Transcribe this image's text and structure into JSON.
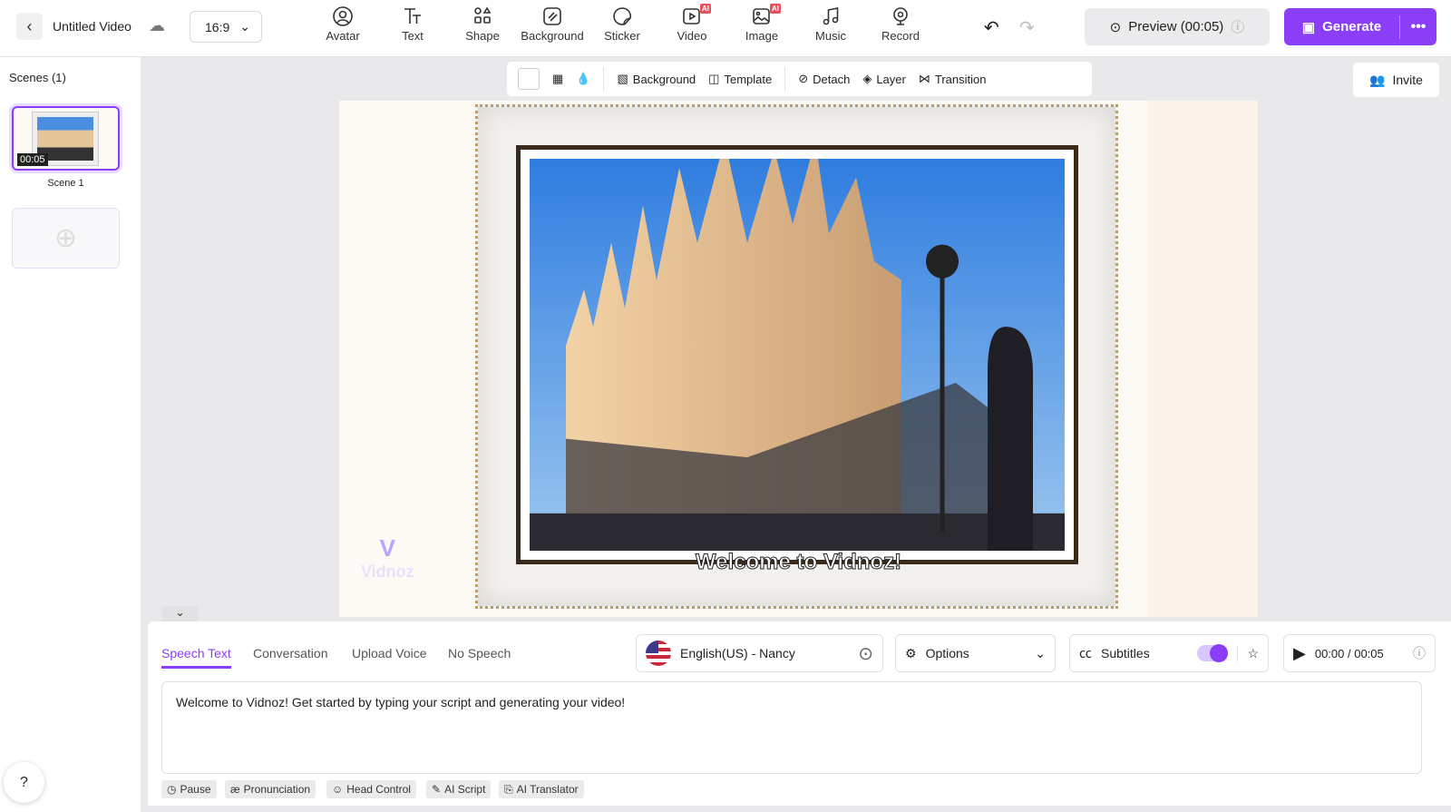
{
  "header": {
    "title": "Untitled Video",
    "aspect_ratio": "16:9",
    "tools": [
      {
        "label": "Avatar",
        "icon": "avatar-icon"
      },
      {
        "label": "Text",
        "icon": "text-icon"
      },
      {
        "label": "Shape",
        "icon": "shape-icon"
      },
      {
        "label": "Background",
        "icon": "background-icon"
      },
      {
        "label": "Sticker",
        "icon": "sticker-icon"
      },
      {
        "label": "Video",
        "icon": "video-icon",
        "badge": "AI"
      },
      {
        "label": "Image",
        "icon": "image-icon",
        "badge": "AI"
      },
      {
        "label": "Music",
        "icon": "music-icon"
      },
      {
        "label": "Record",
        "icon": "record-icon"
      }
    ],
    "preview": "Preview (00:05)",
    "generate": "Generate"
  },
  "sidebar": {
    "scenes_label": "Scenes (1)",
    "scenes": [
      {
        "name": "Scene 1",
        "duration": "00:05"
      }
    ]
  },
  "context_toolbar": {
    "background": "Background",
    "template": "Template",
    "detach": "Detach",
    "layer": "Layer",
    "transition": "Transition"
  },
  "invite": "Invite",
  "canvas": {
    "subtitle": "Welcome to Vidnoz!",
    "watermark": "Vidnoz"
  },
  "speech": {
    "tabs": [
      "Speech Text",
      "Conversation",
      "Upload Voice",
      "No Speech"
    ],
    "active_tab": "Speech Text",
    "voice": "English(US) - Nancy",
    "options": "Options",
    "subtitles": "Subtitles",
    "subtitles_on": true,
    "time": "00:00 / 00:05",
    "script": "Welcome to Vidnoz! Get started by typing your script and generating your video!",
    "chips": [
      "Pause",
      "Pronunciation",
      "Head Control",
      "AI Script",
      "AI Translator"
    ]
  },
  "colors": {
    "accent": "#8a3ff7"
  }
}
